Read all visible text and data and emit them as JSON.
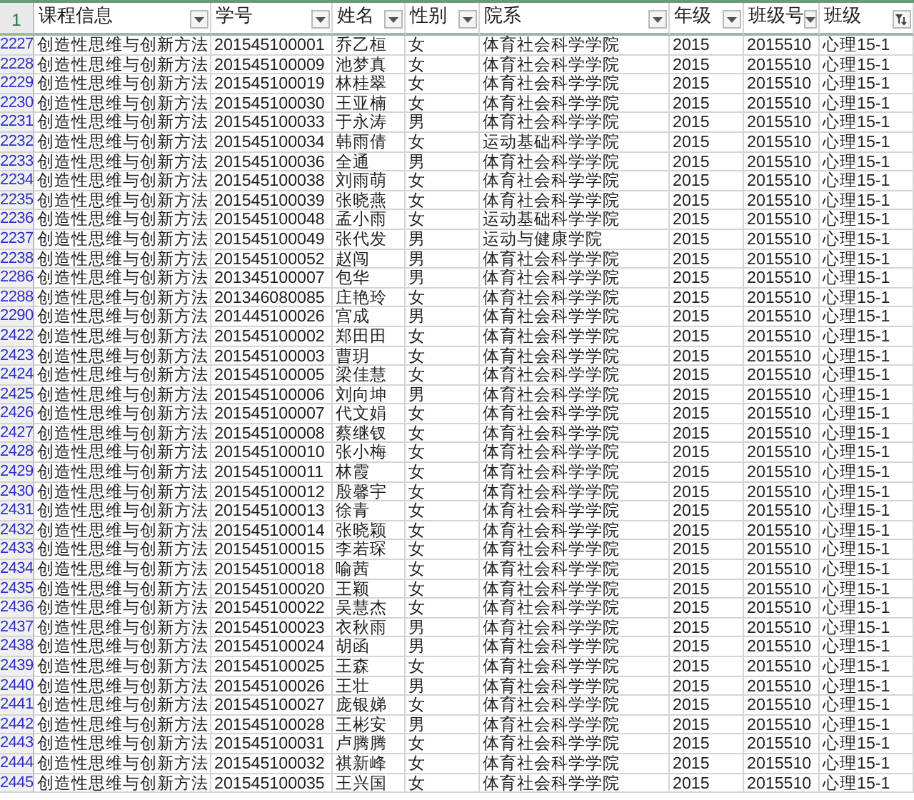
{
  "table": {
    "corner": "1",
    "columns": [
      {
        "label": "课程信息",
        "filtered": false
      },
      {
        "label": "学号",
        "filtered": false
      },
      {
        "label": "姓名",
        "filtered": false
      },
      {
        "label": "性别",
        "filtered": false
      },
      {
        "label": "院系",
        "filtered": false
      },
      {
        "label": "年级",
        "filtered": false
      },
      {
        "label": "班级号",
        "filtered": false
      },
      {
        "label": "班级",
        "filtered": true
      }
    ],
    "rows": [
      {
        "row_number": "2227",
        "cells": [
          "创造性思维与创新方法",
          "201545100001",
          "乔乙桓",
          "女",
          "体育社会科学学院",
          "2015",
          "2015510",
          "心理15-1"
        ]
      },
      {
        "row_number": "2228",
        "cells": [
          "创造性思维与创新方法",
          "201545100009",
          "池梦真",
          "女",
          "体育社会科学学院",
          "2015",
          "2015510",
          "心理15-1"
        ]
      },
      {
        "row_number": "2229",
        "cells": [
          "创造性思维与创新方法",
          "201545100019",
          "林桂翠",
          "女",
          "体育社会科学学院",
          "2015",
          "2015510",
          "心理15-1"
        ]
      },
      {
        "row_number": "2230",
        "cells": [
          "创造性思维与创新方法",
          "201545100030",
          "王亚楠",
          "女",
          "体育社会科学学院",
          "2015",
          "2015510",
          "心理15-1"
        ]
      },
      {
        "row_number": "2231",
        "cells": [
          "创造性思维与创新方法",
          "201545100033",
          "于永涛",
          "男",
          "体育社会科学学院",
          "2015",
          "2015510",
          "心理15-1"
        ]
      },
      {
        "row_number": "2232",
        "cells": [
          "创造性思维与创新方法",
          "201545100034",
          "韩雨倩",
          "女",
          "运动基础科学学院",
          "2015",
          "2015510",
          "心理15-1"
        ]
      },
      {
        "row_number": "2233",
        "cells": [
          "创造性思维与创新方法",
          "201545100036",
          "全通",
          "男",
          "体育社会科学学院",
          "2015",
          "2015510",
          "心理15-1"
        ]
      },
      {
        "row_number": "2234",
        "cells": [
          "创造性思维与创新方法",
          "201545100038",
          "刘雨萌",
          "女",
          "体育社会科学学院",
          "2015",
          "2015510",
          "心理15-1"
        ]
      },
      {
        "row_number": "2235",
        "cells": [
          "创造性思维与创新方法",
          "201545100039",
          "张晓燕",
          "女",
          "体育社会科学学院",
          "2015",
          "2015510",
          "心理15-1"
        ]
      },
      {
        "row_number": "2236",
        "cells": [
          "创造性思维与创新方法",
          "201545100048",
          "孟小雨",
          "女",
          "运动基础科学学院",
          "2015",
          "2015510",
          "心理15-1"
        ]
      },
      {
        "row_number": "2237",
        "cells": [
          "创造性思维与创新方法",
          "201545100049",
          "张代发",
          "男",
          "运动与健康学院",
          "2015",
          "2015510",
          "心理15-1"
        ]
      },
      {
        "row_number": "2238",
        "cells": [
          "创造性思维与创新方法",
          "201545100052",
          "赵闯",
          "男",
          "体育社会科学学院",
          "2015",
          "2015510",
          "心理15-1"
        ]
      },
      {
        "row_number": "2286",
        "cells": [
          "创造性思维与创新方法",
          "201345100007",
          "包华",
          "男",
          "体育社会科学学院",
          "2015",
          "2015510",
          "心理15-1"
        ]
      },
      {
        "row_number": "2288",
        "cells": [
          "创造性思维与创新方法",
          "201346080085",
          "庄艳玲",
          "女",
          "体育社会科学学院",
          "2015",
          "2015510",
          "心理15-1"
        ]
      },
      {
        "row_number": "2290",
        "cells": [
          "创造性思维与创新方法",
          "201445100026",
          "宫成",
          "男",
          "体育社会科学学院",
          "2015",
          "2015510",
          "心理15-1"
        ]
      },
      {
        "row_number": "2422",
        "cells": [
          "创造性思维与创新方法",
          "201545100002",
          "郑田田",
          "女",
          "体育社会科学学院",
          "2015",
          "2015510",
          "心理15-1"
        ]
      },
      {
        "row_number": "2423",
        "cells": [
          "创造性思维与创新方法",
          "201545100003",
          "曹玥",
          "女",
          "体育社会科学学院",
          "2015",
          "2015510",
          "心理15-1"
        ]
      },
      {
        "row_number": "2424",
        "cells": [
          "创造性思维与创新方法",
          "201545100005",
          "梁佳慧",
          "女",
          "体育社会科学学院",
          "2015",
          "2015510",
          "心理15-1"
        ]
      },
      {
        "row_number": "2425",
        "cells": [
          "创造性思维与创新方法",
          "201545100006",
          "刘向坤",
          "男",
          "体育社会科学学院",
          "2015",
          "2015510",
          "心理15-1"
        ]
      },
      {
        "row_number": "2426",
        "cells": [
          "创造性思维与创新方法",
          "201545100007",
          "代文娟",
          "女",
          "体育社会科学学院",
          "2015",
          "2015510",
          "心理15-1"
        ]
      },
      {
        "row_number": "2427",
        "cells": [
          "创造性思维与创新方法",
          "201545100008",
          "蔡继钗",
          "女",
          "体育社会科学学院",
          "2015",
          "2015510",
          "心理15-1"
        ]
      },
      {
        "row_number": "2428",
        "cells": [
          "创造性思维与创新方法",
          "201545100010",
          "张小梅",
          "女",
          "体育社会科学学院",
          "2015",
          "2015510",
          "心理15-1"
        ]
      },
      {
        "row_number": "2429",
        "cells": [
          "创造性思维与创新方法",
          "201545100011",
          "林霞",
          "女",
          "体育社会科学学院",
          "2015",
          "2015510",
          "心理15-1"
        ]
      },
      {
        "row_number": "2430",
        "cells": [
          "创造性思维与创新方法",
          "201545100012",
          "殷馨宇",
          "女",
          "体育社会科学学院",
          "2015",
          "2015510",
          "心理15-1"
        ]
      },
      {
        "row_number": "2431",
        "cells": [
          "创造性思维与创新方法",
          "201545100013",
          "徐青",
          "女",
          "体育社会科学学院",
          "2015",
          "2015510",
          "心理15-1"
        ]
      },
      {
        "row_number": "2432",
        "cells": [
          "创造性思维与创新方法",
          "201545100014",
          "张晓颖",
          "女",
          "体育社会科学学院",
          "2015",
          "2015510",
          "心理15-1"
        ]
      },
      {
        "row_number": "2433",
        "cells": [
          "创造性思维与创新方法",
          "201545100015",
          "李若琛",
          "女",
          "体育社会科学学院",
          "2015",
          "2015510",
          "心理15-1"
        ]
      },
      {
        "row_number": "2434",
        "cells": [
          "创造性思维与创新方法",
          "201545100018",
          "喻茜",
          "女",
          "体育社会科学学院",
          "2015",
          "2015510",
          "心理15-1"
        ]
      },
      {
        "row_number": "2435",
        "cells": [
          "创造性思维与创新方法",
          "201545100020",
          "王颖",
          "女",
          "体育社会科学学院",
          "2015",
          "2015510",
          "心理15-1"
        ]
      },
      {
        "row_number": "2436",
        "cells": [
          "创造性思维与创新方法",
          "201545100022",
          "吴慧杰",
          "女",
          "体育社会科学学院",
          "2015",
          "2015510",
          "心理15-1"
        ]
      },
      {
        "row_number": "2437",
        "cells": [
          "创造性思维与创新方法",
          "201545100023",
          "衣秋雨",
          "男",
          "体育社会科学学院",
          "2015",
          "2015510",
          "心理15-1"
        ]
      },
      {
        "row_number": "2438",
        "cells": [
          "创造性思维与创新方法",
          "201545100024",
          "胡函",
          "男",
          "体育社会科学学院",
          "2015",
          "2015510",
          "心理15-1"
        ]
      },
      {
        "row_number": "2439",
        "cells": [
          "创造性思维与创新方法",
          "201545100025",
          "王森",
          "女",
          "体育社会科学学院",
          "2015",
          "2015510",
          "心理15-1"
        ]
      },
      {
        "row_number": "2440",
        "cells": [
          "创造性思维与创新方法",
          "201545100026",
          "王壮",
          "男",
          "体育社会科学学院",
          "2015",
          "2015510",
          "心理15-1"
        ]
      },
      {
        "row_number": "2441",
        "cells": [
          "创造性思维与创新方法",
          "201545100027",
          "庞银娣",
          "女",
          "体育社会科学学院",
          "2015",
          "2015510",
          "心理15-1"
        ]
      },
      {
        "row_number": "2442",
        "cells": [
          "创造性思维与创新方法",
          "201545100028",
          "王彬安",
          "男",
          "体育社会科学学院",
          "2015",
          "2015510",
          "心理15-1"
        ]
      },
      {
        "row_number": "2443",
        "cells": [
          "创造性思维与创新方法",
          "201545100031",
          "卢腾腾",
          "女",
          "体育社会科学学院",
          "2015",
          "2015510",
          "心理15-1"
        ]
      },
      {
        "row_number": "2444",
        "cells": [
          "创造性思维与创新方法",
          "201545100032",
          "祺新峰",
          "女",
          "体育社会科学学院",
          "2015",
          "2015510",
          "心理15-1"
        ]
      },
      {
        "row_number": "2445",
        "cells": [
          "创造性思维与创新方法",
          "201545100035",
          "王兴国",
          "女",
          "体育社会科学学院",
          "2015",
          "2015510",
          "心理15-1"
        ]
      }
    ]
  }
}
